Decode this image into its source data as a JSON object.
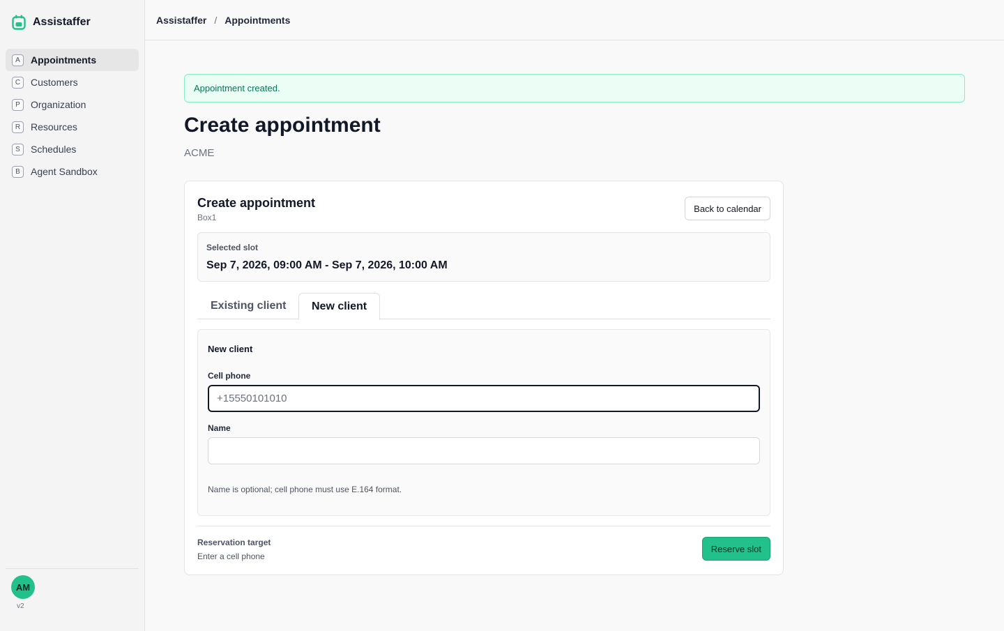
{
  "app": {
    "name": "Assistaffer",
    "brand_icon": "calendar-icon",
    "accent_color": "#22c08a",
    "version": "v2"
  },
  "sidebar": {
    "items": [
      {
        "key": "A",
        "label": "Appointments",
        "active": true
      },
      {
        "key": "C",
        "label": "Customers",
        "active": false
      },
      {
        "key": "P",
        "label": "Organization",
        "active": false
      },
      {
        "key": "R",
        "label": "Resources",
        "active": false
      },
      {
        "key": "S",
        "label": "Schedules",
        "active": false
      },
      {
        "key": "B",
        "label": "Agent Sandbox",
        "active": false
      }
    ],
    "user_initials": "AM"
  },
  "breadcrumb": {
    "root": "Assistaffer",
    "separator": "/",
    "current": "Appointments"
  },
  "alert": {
    "message": "Appointment created.",
    "color": "#047857"
  },
  "page": {
    "title": "Create appointment",
    "subtitle": "ACME"
  },
  "card": {
    "title": "Create appointment",
    "subtitle": "Box1",
    "back_button": "Back to calendar",
    "slot": {
      "label": "Selected slot",
      "value": "Sep 7, 2026, 09:00 AM - Sep 7, 2026, 10:00 AM"
    },
    "tabs": [
      {
        "label": "Existing client",
        "active": false
      },
      {
        "label": "New client",
        "active": true
      }
    ],
    "form": {
      "heading": "New client",
      "phone_label": "Cell phone",
      "phone_placeholder": "+15550101010",
      "phone_value": "",
      "name_label": "Name",
      "name_placeholder": "",
      "name_value": "",
      "hint": "Name is optional; cell phone must use E.164 format."
    },
    "reservation": {
      "label": "Reservation target",
      "value": "Enter a cell phone",
      "button": "Reserve slot"
    }
  }
}
